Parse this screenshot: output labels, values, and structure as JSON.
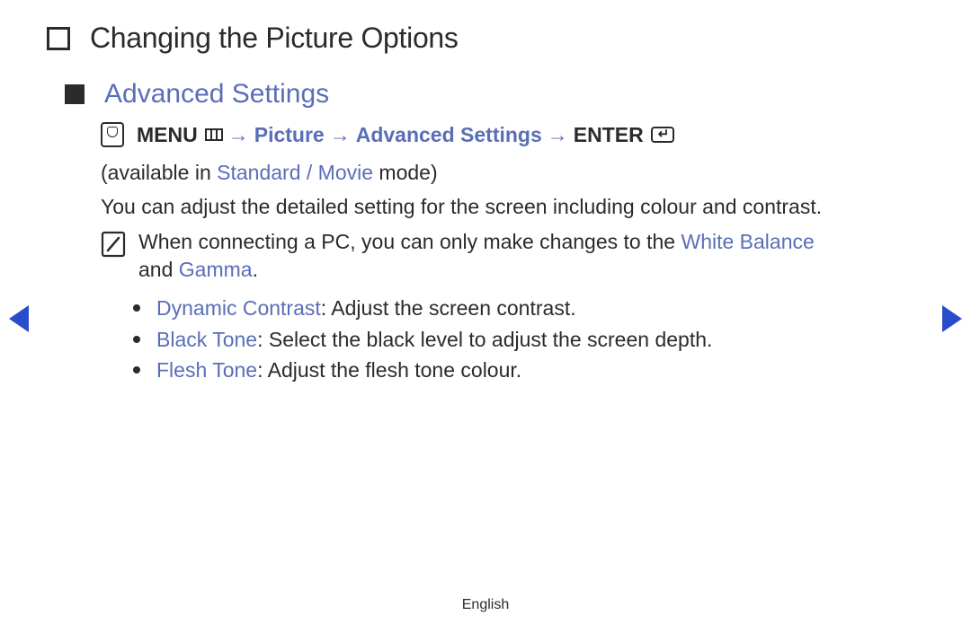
{
  "page_title": "Changing the Picture Options",
  "section_title": "Advanced Settings",
  "breadcrumb": {
    "menu_label": "MENU",
    "arrow": "→",
    "picture": "Picture",
    "advanced": "Advanced Settings",
    "enter_label": "ENTER"
  },
  "availability": {
    "prefix": "(available in ",
    "mode": "Standard / Movie",
    "suffix": " mode)"
  },
  "description": "You can adjust the detailed setting for the screen including colour and contrast.",
  "note": {
    "part1": "When connecting a PC, you can only make changes to the ",
    "white_balance": "White Balance",
    "and_text": "and ",
    "gamma": "Gamma",
    "period": "."
  },
  "options": [
    {
      "name": "Dynamic Contrast",
      "desc": ": Adjust the screen contrast."
    },
    {
      "name": "Black Tone",
      "desc": ": Select the black level to adjust the screen depth."
    },
    {
      "name": "Flesh Tone",
      "desc": ": Adjust the flesh tone colour."
    }
  ],
  "footer": "English"
}
